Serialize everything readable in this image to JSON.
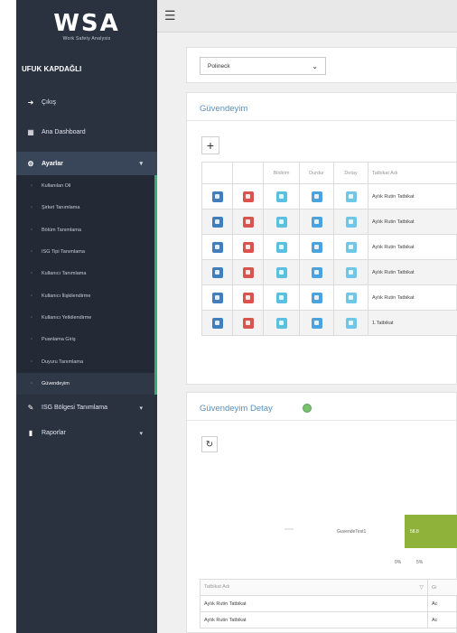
{
  "logo": {
    "main": "WSA",
    "sub": "Work Safety Analysis"
  },
  "user": {
    "name": "UFUK KAPDAĞLI"
  },
  "menu": {
    "exit": "Çıkış",
    "dashboard": "Ana Dashboard",
    "settings": "Ayarlar",
    "settings_sub": [
      "Kullanılan Oil",
      "Şirket Tanımlama",
      "Bölüm Tanımlama",
      "ISG Tipi Tanımlama",
      "Kullanıcı Tanımlama",
      "Kullanıcı İlişkilendirme",
      "Kullanıcı Yetkilendirme",
      "Puanlama Giriş",
      "Duyuru Tanımlama",
      "Güvendeyim"
    ],
    "isg_region": "ISG Bölgesi Tanımlama",
    "reports": "Raporlar"
  },
  "filter": {
    "selected": "Polineck"
  },
  "panel1": {
    "title": "Güvendeyim",
    "add_label": "+",
    "columns": [
      "",
      "",
      "Bildirim",
      "Durdur",
      "Detay",
      "Tatbikat Adı"
    ],
    "rows": [
      {
        "name": "Aylık Rutin Tatbikat"
      },
      {
        "name": "Aylık Rutin Tatbikat"
      },
      {
        "name": "Aylık Rutin Tatbikat"
      },
      {
        "name": "Aylık Rutin Tatbikat"
      },
      {
        "name": "Aylık Rutin Tatbikat"
      },
      {
        "name": "1.Tatbikat"
      }
    ]
  },
  "panel2": {
    "title": "Güvendeyim Detay",
    "refresh_label": "↻",
    "chart_data": {
      "type": "bar",
      "orientation": "horizontal",
      "categories": [
        "GuvendeTest1"
      ],
      "values": [
        58
      ],
      "value_labels": [
        "58.8"
      ],
      "axis_ticks": [
        "0%",
        "5%"
      ]
    },
    "detail_header": "Tatbikat Adı",
    "detail_header2": "Gi",
    "detail_rows": [
      {
        "name": "Aylık Rutin Tatbikat",
        "col2": "Ac"
      },
      {
        "name": "Aylık Rutin Tatbikat",
        "col2": "Ac"
      }
    ]
  },
  "colors": {
    "sidebar": "#2a3240",
    "accent": "#39a97a",
    "bar": "#8fb33a",
    "title": "#5a8fb8"
  }
}
